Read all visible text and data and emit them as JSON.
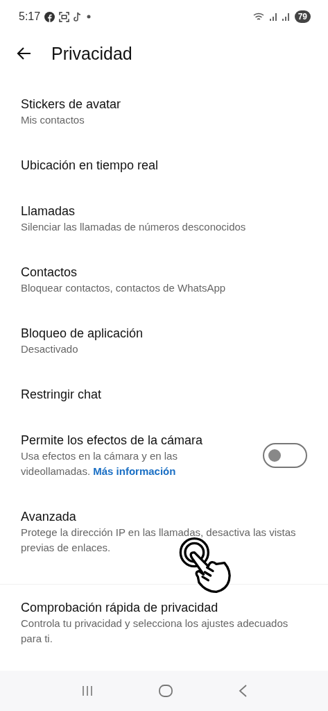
{
  "status_bar": {
    "time": "5:17",
    "battery": "79"
  },
  "header": {
    "title": "Privacidad"
  },
  "items": [
    {
      "kind": "link",
      "title": "Stickers de avatar",
      "subtitle": "Mis contactos"
    },
    {
      "kind": "link",
      "title": "Ubicación en tiempo real"
    },
    {
      "kind": "link",
      "title": "Llamadas",
      "subtitle": "Silenciar las llamadas de números desconocidos"
    },
    {
      "kind": "link",
      "title": "Contactos",
      "subtitle": "Bloquear contactos, contactos de WhatsApp"
    },
    {
      "kind": "link",
      "title": "Bloqueo de aplicación",
      "subtitle": "Desactivado"
    },
    {
      "kind": "link",
      "title": "Restringir chat"
    },
    {
      "kind": "toggle",
      "title": "Permite los efectos de la cámara",
      "subtitle": "Usa efectos en la cámara y en las videollamadas.",
      "link": "Más información",
      "on": false
    },
    {
      "kind": "link",
      "title": "Avanzada",
      "subtitle": "Protege la dirección IP en las llamadas, desactiva las vistas previas de enlaces."
    },
    {
      "kind": "link",
      "title": "Comprobación rápida de privacidad",
      "subtitle": "Controla tu privacidad y selecciona los ajustes adecuados para ti.",
      "divider": true
    }
  ]
}
